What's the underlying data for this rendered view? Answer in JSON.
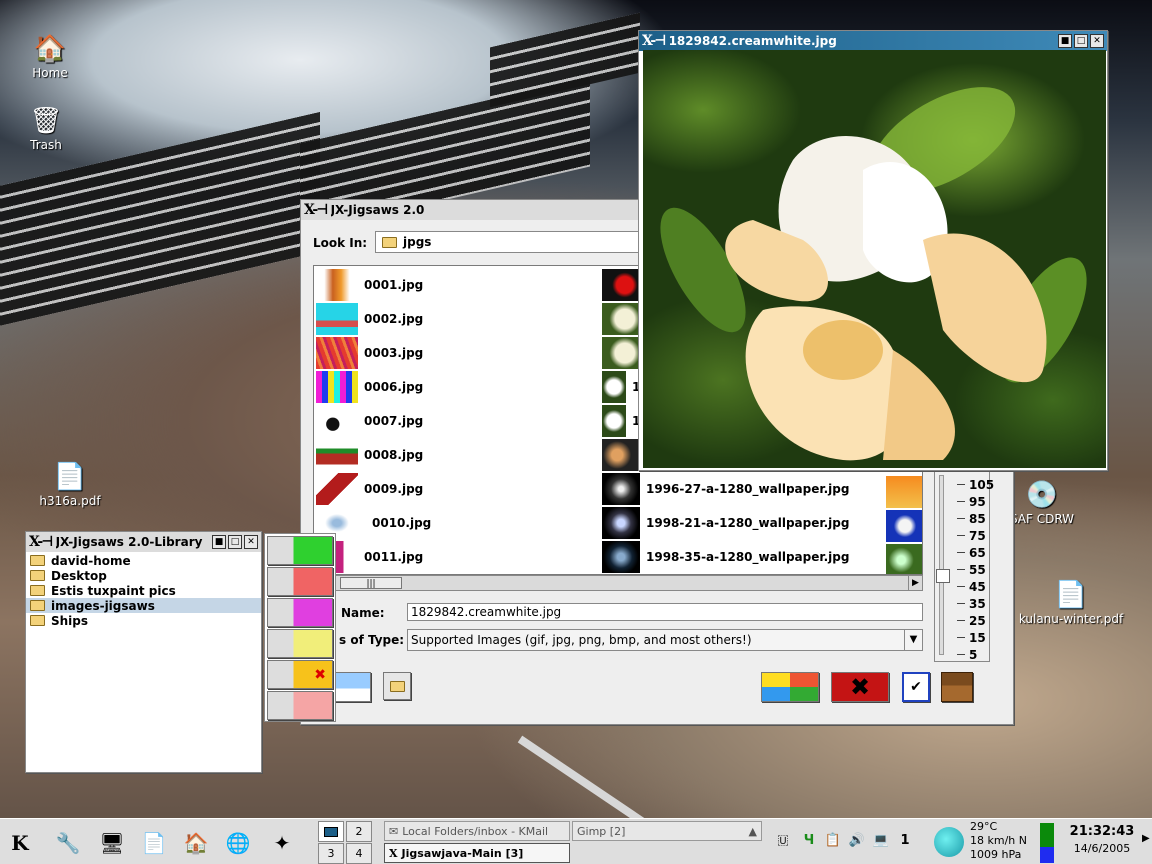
{
  "desktop": {
    "icons": [
      {
        "label": "Home",
        "icon": "home-icon"
      },
      {
        "label": "Trash",
        "icon": "trash-icon"
      },
      {
        "label": "h316a.pdf",
        "icon": "pdf-icon"
      },
      {
        "label": "SAF CDRW",
        "icon": "cdrom-icon"
      },
      {
        "label": "kulanu-winter.pdf",
        "icon": "pdf-icon"
      }
    ]
  },
  "image_viewer": {
    "title": "1829842.creamwhite.jpg"
  },
  "chooser": {
    "title": "JX-Jigsaws 2.0",
    "look_in_label": "Look In:",
    "look_in_value": "jpgs",
    "files_col1": [
      "0001.jpg",
      "0002.jpg",
      "0003.jpg",
      "0006.jpg",
      "0007.jpg",
      "0008.jpg",
      "0009.jpg",
      "0010.jpg",
      "0011.jpg"
    ],
    "files_col2_partial": [
      "",
      "",
      "",
      "1",
      "1",
      "",
      "",
      "",
      ""
    ],
    "files_col2": [
      "1996-27-a-1280_wallpaper.jpg",
      "1998-21-a-1280_wallpaper.jpg",
      "1998-35-a-1280_wallpaper.jpg"
    ],
    "name_label": "Name:",
    "name_value": "1829842.creamwhite.jpg",
    "type_label": "s of Type:",
    "type_value": "Supported Images (gif, jpg, png, bmp, and most others!)",
    "ruler_values": [
      "105",
      "95",
      "85",
      "75",
      "65",
      "55",
      "45",
      "35",
      "25",
      "15",
      "5"
    ],
    "colors": {
      "accent": "#1c5f88",
      "selection": "#c5d6e6"
    }
  },
  "library": {
    "title": "JX-Jigsaws 2.0-Library",
    "items": [
      "david-home",
      "Desktop",
      "Estis tuxpaint pics",
      "images-jigsaws",
      "Ships"
    ],
    "selected": "images-jigsaws"
  },
  "taskbar": {
    "pager": [
      "2",
      "3",
      "4"
    ],
    "tasks": [
      {
        "label": "Local Folders/inbox - KMail",
        "active": false
      },
      {
        "label": "Gimp [2]",
        "active": false
      },
      {
        "label": "Jigsawjava-Main [3]",
        "active": true
      }
    ],
    "weather": {
      "temp": "29°C",
      "wind": "18 km/h N",
      "pressure": "1009 hPa"
    },
    "clock": {
      "time": "21:32:43",
      "date": "14/6/2005"
    },
    "tray_badge": "1"
  }
}
